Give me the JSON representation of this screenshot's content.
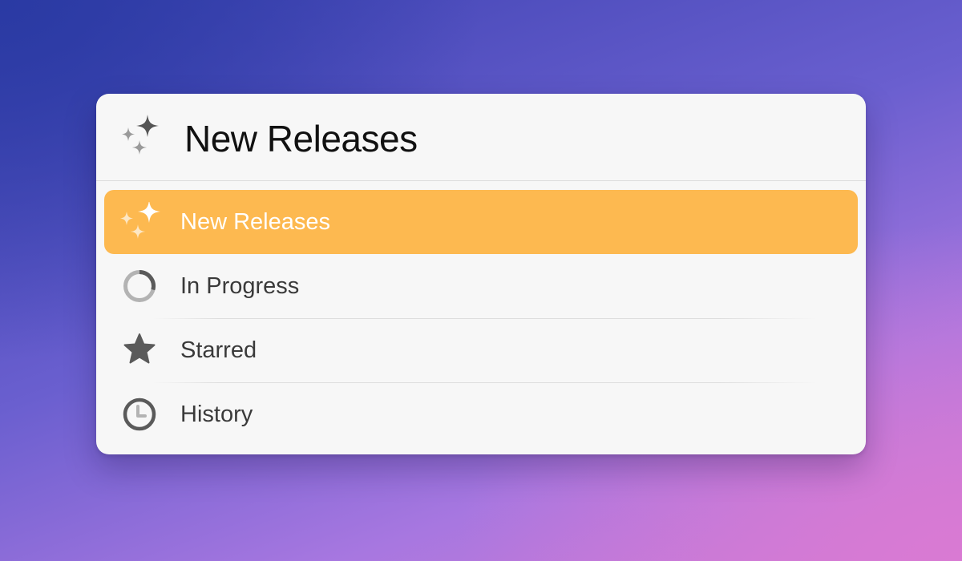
{
  "window": {
    "title": "New Releases",
    "title_icon": "sparkles-icon"
  },
  "menu": {
    "selected_index": 0,
    "items": [
      {
        "label": "New Releases",
        "icon": "sparkles-icon",
        "selected": true
      },
      {
        "label": "In Progress",
        "icon": "progress-ring-icon",
        "selected": false
      },
      {
        "label": "Starred",
        "icon": "star-icon",
        "selected": false
      },
      {
        "label": "History",
        "icon": "clock-icon",
        "selected": false
      }
    ]
  },
  "colors": {
    "selection": "#fdb950",
    "panel_background": "#f7f7f7",
    "icon_gray": "#5a5a5a",
    "text": "#3a3a3a"
  }
}
